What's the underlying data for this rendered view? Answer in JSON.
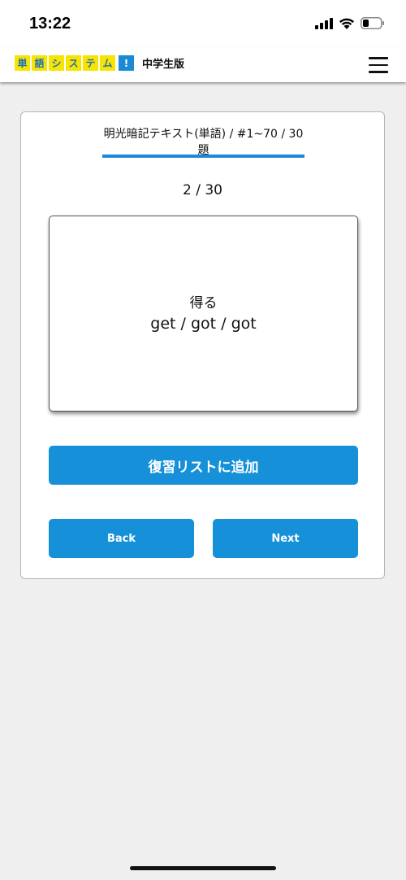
{
  "status_bar": {
    "time": "13:22",
    "icons": [
      "signal-icon",
      "wifi-icon",
      "battery-icon"
    ]
  },
  "header": {
    "logo_chars": [
      "単",
      "語",
      "シ",
      "ス",
      "テ",
      "ム",
      "!"
    ],
    "edition": "中学生版",
    "menu_icon": "menu-icon"
  },
  "quiz": {
    "tab_label": "明光暗記テキスト(単語) / #1~70 / 30題",
    "progress": "2 / 30",
    "card": {
      "japanese": "得る",
      "english": "get / got / got"
    },
    "add_review_label": "復習リストに追加",
    "back_label": "Back",
    "next_label": "Next"
  },
  "colors": {
    "accent": "#1590d9",
    "logo_yellow": "#f7e400",
    "logo_blue": "#1a8ad6",
    "background": "#efefef"
  }
}
